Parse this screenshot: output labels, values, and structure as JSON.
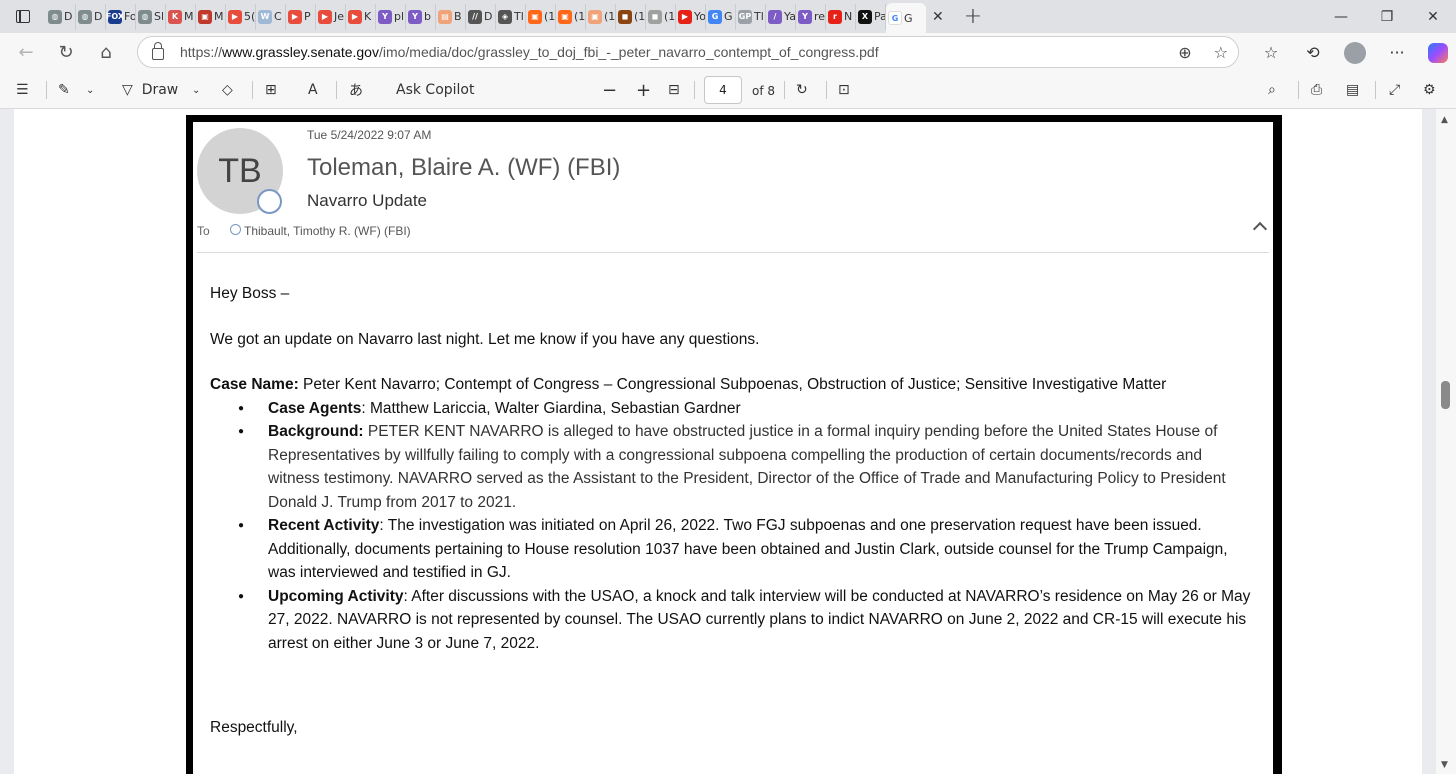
{
  "browser": {
    "tabs": [
      {
        "label": "D",
        "color": "#7f8c8d",
        "glyph": "◍"
      },
      {
        "label": "D",
        "color": "#7f8c8d",
        "glyph": "◍"
      },
      {
        "label": "Fo",
        "color": "#1a3c8f",
        "glyph": "FOX"
      },
      {
        "label": "Sl",
        "color": "#7f8c8d",
        "glyph": "◍"
      },
      {
        "label": "M",
        "color": "#d9534f",
        "glyph": "K"
      },
      {
        "label": "M",
        "color": "#c0392b",
        "glyph": "▣"
      },
      {
        "label": "5(",
        "color": "#e74c3c",
        "glyph": "▶"
      },
      {
        "label": "C",
        "color": "#9fb8d6",
        "glyph": "W"
      },
      {
        "label": "P",
        "color": "#e74c3c",
        "glyph": "▶"
      },
      {
        "label": "Je",
        "color": "#e74c3c",
        "glyph": "▶"
      },
      {
        "label": "K",
        "color": "#e74c3c",
        "glyph": "▶"
      },
      {
        "label": "pl",
        "color": "#7d5cc6",
        "glyph": "Y"
      },
      {
        "label": "b",
        "color": "#7d5cc6",
        "glyph": "Y"
      },
      {
        "label": "B",
        "color": "#f0a37a",
        "glyph": "▤"
      },
      {
        "label": "D",
        "color": "#555",
        "glyph": "//"
      },
      {
        "label": "Tl",
        "color": "#555",
        "glyph": "◈"
      },
      {
        "label": "(1",
        "color": "#ff6719",
        "glyph": "▣"
      },
      {
        "label": "(1",
        "color": "#ff6719",
        "glyph": "▣"
      },
      {
        "label": "(1",
        "color": "#f0a37a",
        "glyph": "▣"
      },
      {
        "label": "(1",
        "color": "#8b4513",
        "glyph": "◼"
      },
      {
        "label": "(1",
        "color": "#a0a0a0",
        "glyph": "◼"
      },
      {
        "label": "Yo",
        "color": "#e62117",
        "glyph": "▶"
      },
      {
        "label": "G",
        "color": "#4285f4",
        "glyph": "G"
      },
      {
        "label": "Tl",
        "color": "#9aa0a6",
        "glyph": "GP"
      },
      {
        "label": "Ya",
        "color": "#7d5cc6",
        "glyph": "/"
      },
      {
        "label": "re",
        "color": "#7d5cc6",
        "glyph": "Y"
      },
      {
        "label": "N",
        "color": "#e62117",
        "glyph": "r"
      },
      {
        "label": "Pa",
        "color": "#111",
        "glyph": "X"
      }
    ],
    "active_tab": {
      "label": "G",
      "color": "#4285f4",
      "glyph": "G"
    },
    "url_prefix": "https://",
    "url_domain": "www.grassley.senate.gov",
    "url_path": "/imo/media/doc/grassley_to_doj_fbi_-_peter_navarro_contempt_of_congress.pdf"
  },
  "pdf_toolbar": {
    "draw_label": "Draw",
    "ask_copilot_label": "Ask Copilot",
    "page_current": "4",
    "page_total": "of 8"
  },
  "email": {
    "initials": "TB",
    "date": "Tue 5/24/2022 9:07 AM",
    "sender": "Toleman, Blaire A. (WF) (FBI)",
    "subject": "Navarro Update",
    "to_label": "To",
    "to_name": "Thibault, Timothy R. (WF) (FBI)",
    "greeting": "Hey Boss –",
    "intro": "We got an update on Navarro last night. Let me know if you have any questions.",
    "case_name_label": "Case Name:",
    "case_name": " Peter Kent Navarro; Contempt of Congress – Congressional Subpoenas, Obstruction of Justice; Sensitive Investigative Matter",
    "items": [
      {
        "label": "Case Agents",
        "sep": ": ",
        "text": "Matthew Lariccia, Walter Giardina, Sebastian Gardner"
      },
      {
        "label": "Background:",
        "sep": " ",
        "text": "PETER KENT NAVARRO is alleged to have obstructed justice in a formal inquiry pending before the United States House of Representatives by willfully failing to comply with a congressional subpoena compelling the production of certain documents/records and witness testimony. NAVARRO served as the Assistant to the President, Director of the Office of Trade and Manufacturing Policy to President Donald J. Trump from 2017 to 2021."
      },
      {
        "label": "Recent Activity",
        "sep": ": ",
        "text": "The investigation was initiated on April 26, 2022. Two FGJ subpoenas and one preservation request have been issued. Additionally, documents pertaining to House resolution 1037 have been obtained and Justin Clark, outside counsel for the Trump Campaign, was interviewed and testified in GJ."
      },
      {
        "label": "Upcoming Activity",
        "sep": ": ",
        "text": "After discussions with the USAO, a knock and talk interview will be conducted at NAVARRO’s residence on May 26 or May 27, 2022. NAVARRO is not represented by counsel. The USAO currently plans to indict NAVARRO on June 2, 2022 and CR-15 will execute his arrest on either June 3 or June 7, 2022."
      }
    ],
    "closing": "Respectfully,"
  }
}
